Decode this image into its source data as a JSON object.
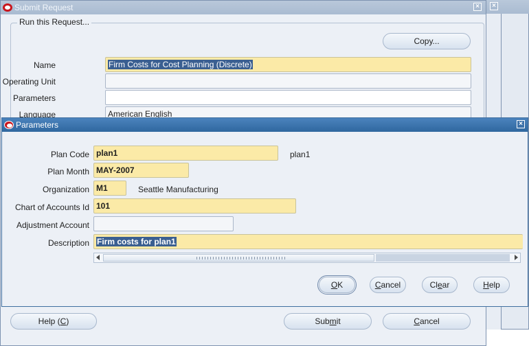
{
  "submit_request": {
    "title": "Submit Request",
    "group_title": "Run this Request...",
    "copy_button": "Copy...",
    "labels": {
      "name": "Name",
      "operating_unit": "Operating Unit",
      "parameters": "Parameters",
      "language": "Language"
    },
    "values": {
      "name": "Firm Costs for Cost Planning (Discrete)",
      "operating_unit": "",
      "parameters": "",
      "language": "American English"
    },
    "buttons": {
      "help": "Help (C)",
      "help_pre": "Help (",
      "help_key": "C",
      "help_post": ")",
      "submit": "Submit",
      "submit_pre": "Sub",
      "submit_key": "m",
      "submit_post": "it",
      "cancel": "Cancel",
      "cancel_pre": "",
      "cancel_key": "C",
      "cancel_post": "ancel"
    }
  },
  "parameters_dialog": {
    "title": "Parameters",
    "fields": {
      "plan_code": {
        "label": "Plan Code",
        "value": "plan1",
        "description": "plan1"
      },
      "plan_month": {
        "label": "Plan Month",
        "value": "MAY-2007"
      },
      "organization": {
        "label": "Organization",
        "value": "M1",
        "description": "Seattle Manufacturing"
      },
      "chart_of_accounts": {
        "label": "Chart of Accounts Id",
        "value": "101"
      },
      "adjustment_account": {
        "label": "Adjustment Account",
        "value": ""
      },
      "description": {
        "label": "Description",
        "value": "Firm costs for plan1"
      }
    },
    "buttons": {
      "ok": {
        "pre": "",
        "key": "O",
        "post": "K"
      },
      "cancel": {
        "pre": "",
        "key": "C",
        "post": "ancel"
      },
      "clear": {
        "pre": "Cl",
        "key": "e",
        "post": "ar"
      },
      "help": {
        "pre": "",
        "key": "H",
        "post": "elp"
      }
    }
  },
  "icons": {
    "oracle": "oracle-logo-icon",
    "close": "close-icon",
    "scroll_left": "scroll-left-icon",
    "scroll_right": "scroll-right-icon"
  },
  "colors": {
    "active_title": "#2f679f",
    "required_field": "#fbeaa7",
    "selection": "#3a5f91",
    "window_bg": "#ecf0f6"
  }
}
